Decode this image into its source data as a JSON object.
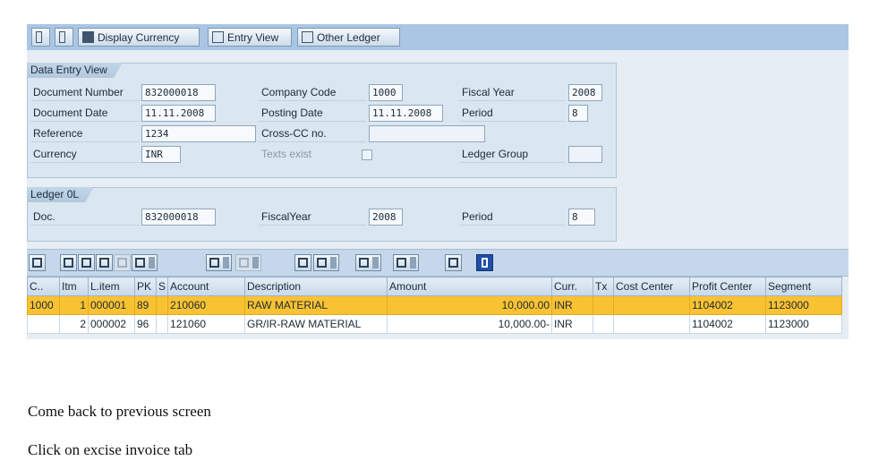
{
  "toolbar": {
    "display_currency": "Display Currency",
    "entry_view": "Entry View",
    "other_ledger": "Other Ledger"
  },
  "data_entry_view": {
    "title": "Data Entry View",
    "document_number_label": "Document Number",
    "document_number": "832000018",
    "company_code_label": "Company Code",
    "company_code": "1000",
    "fiscal_year_label": "Fiscal Year",
    "fiscal_year": "2008",
    "document_date_label": "Document Date",
    "document_date": "11.11.2008",
    "posting_date_label": "Posting Date",
    "posting_date": "11.11.2008",
    "period_label": "Period",
    "period": "8",
    "reference_label": "Reference",
    "reference": "1234",
    "cross_cc_label": "Cross-CC no.",
    "cross_cc": "",
    "currency_label": "Currency",
    "currency": "INR",
    "texts_exist_label": "Texts exist",
    "ledger_group_label": "Ledger Group",
    "ledger_group": ""
  },
  "ledger": {
    "title": "Ledger 0L",
    "doc_label": "Doc.",
    "doc": "832000018",
    "fiscal_year_label": "FiscalYear",
    "fiscal_year": "2008",
    "period_label": "Period",
    "period": "8"
  },
  "grid": {
    "columns": [
      "C..",
      "Itm",
      "L.item",
      "PK",
      "S",
      "Account",
      "Description",
      "Amount",
      "Curr.",
      "Tx",
      "Cost Center",
      "Profit Center",
      "Segment"
    ],
    "rows": [
      {
        "c": "1000",
        "itm": "1",
        "litem": "000001",
        "pk": "89",
        "s": "",
        "account": "210060",
        "description": "RAW MATERIAL",
        "amount": "10,000.00",
        "curr": "INR",
        "tx": "",
        "cost_center": "",
        "profit_center": "1104002",
        "segment": "1123000"
      },
      {
        "c": "",
        "itm": "2",
        "litem": "000002",
        "pk": "96",
        "s": "",
        "account": "121060",
        "description": "GR/IR-RAW MATERIAL",
        "amount": "10,000.00-",
        "curr": "INR",
        "tx": "",
        "cost_center": "",
        "profit_center": "1104002",
        "segment": "1123000"
      }
    ]
  },
  "notes": {
    "line1": "Come back to previous screen",
    "line2": "Click on excise invoice tab"
  },
  "colors": {
    "toolbar": "#a9c6e4",
    "selected_row": "#f9c232",
    "panel": "#dae6f0"
  }
}
